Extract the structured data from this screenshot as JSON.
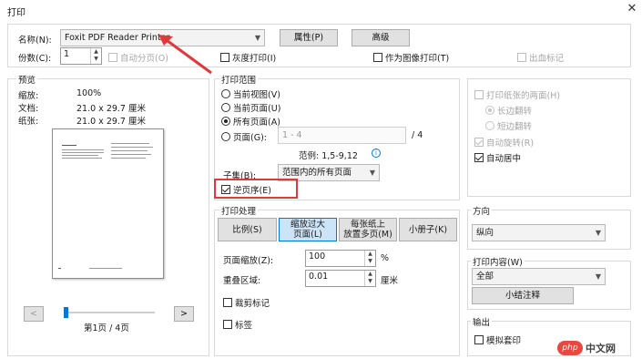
{
  "window": {
    "title": "打印"
  },
  "printer": {
    "name_label": "名称(N):",
    "name_value": "Foxit PDF Reader Printer",
    "properties_button": "属性(P)",
    "advanced_button": "高级"
  },
  "copies": {
    "label": "份数(C):",
    "value": "1",
    "collate_label": "自动分页(O)",
    "grayscale_label": "灰度打印(I)",
    "print_as_image_label": "作为图像打印(T)",
    "bleed_marks_label": "出血标记"
  },
  "preview": {
    "group_label": "预览",
    "scale_label": "缩放:",
    "scale_value": "100%",
    "document_label": "文档:",
    "document_value": "21.0 x 29.7 厘米",
    "paper_label": "纸张:",
    "paper_value": "21.0 x 29.7 厘米",
    "prev_button": "<",
    "next_button": ">",
    "page_indicator": "第1页 / 4页"
  },
  "print_range": {
    "group_label": "打印范围",
    "current_view": "当前视图(V)",
    "current_page": "当前页面(U)",
    "all_pages": "所有页面(A)",
    "pages_label": "页面(G):",
    "pages_value": "1 - 4",
    "pages_total": "/ 4",
    "example_label": "范例: 1,5-9,12",
    "subset_label": "子集(B):",
    "subset_value": "范围内的所有页面",
    "reverse_label": "逆页序(E)"
  },
  "print_handling": {
    "group_label": "打印处理",
    "mode_scale": "比例(S)",
    "mode_fit_line1": "缩放过大",
    "mode_fit_line2": "页面(L)",
    "mode_multiple_line1": "每张纸上",
    "mode_multiple_line2": "放置多页(M)",
    "mode_booklet": "小册子(K)",
    "page_scale_label": "页面缩放(Z):",
    "page_scale_value": "100",
    "page_scale_unit": "%",
    "overlap_label": "重叠区域:",
    "overlap_value": "0.01",
    "overlap_unit": "厘米",
    "cut_marks_label": "裁剪标记",
    "labels_label": "标签"
  },
  "duplex": {
    "both_sides_label": "打印纸张的两面(H)",
    "long_edge": "长边翻转",
    "short_edge": "短边翻转",
    "auto_rotate": "自动旋转(R)",
    "auto_center": "自动居中"
  },
  "orientation": {
    "group_label": "方向",
    "value": "纵向"
  },
  "print_content": {
    "group_label": "打印内容(W)",
    "value": "全部",
    "summarize_button": "小结注释"
  },
  "output": {
    "group_label": "输出",
    "simulate_overprint": "模拟套印"
  },
  "watermark": {
    "text": "中文网",
    "prefix": "php"
  }
}
